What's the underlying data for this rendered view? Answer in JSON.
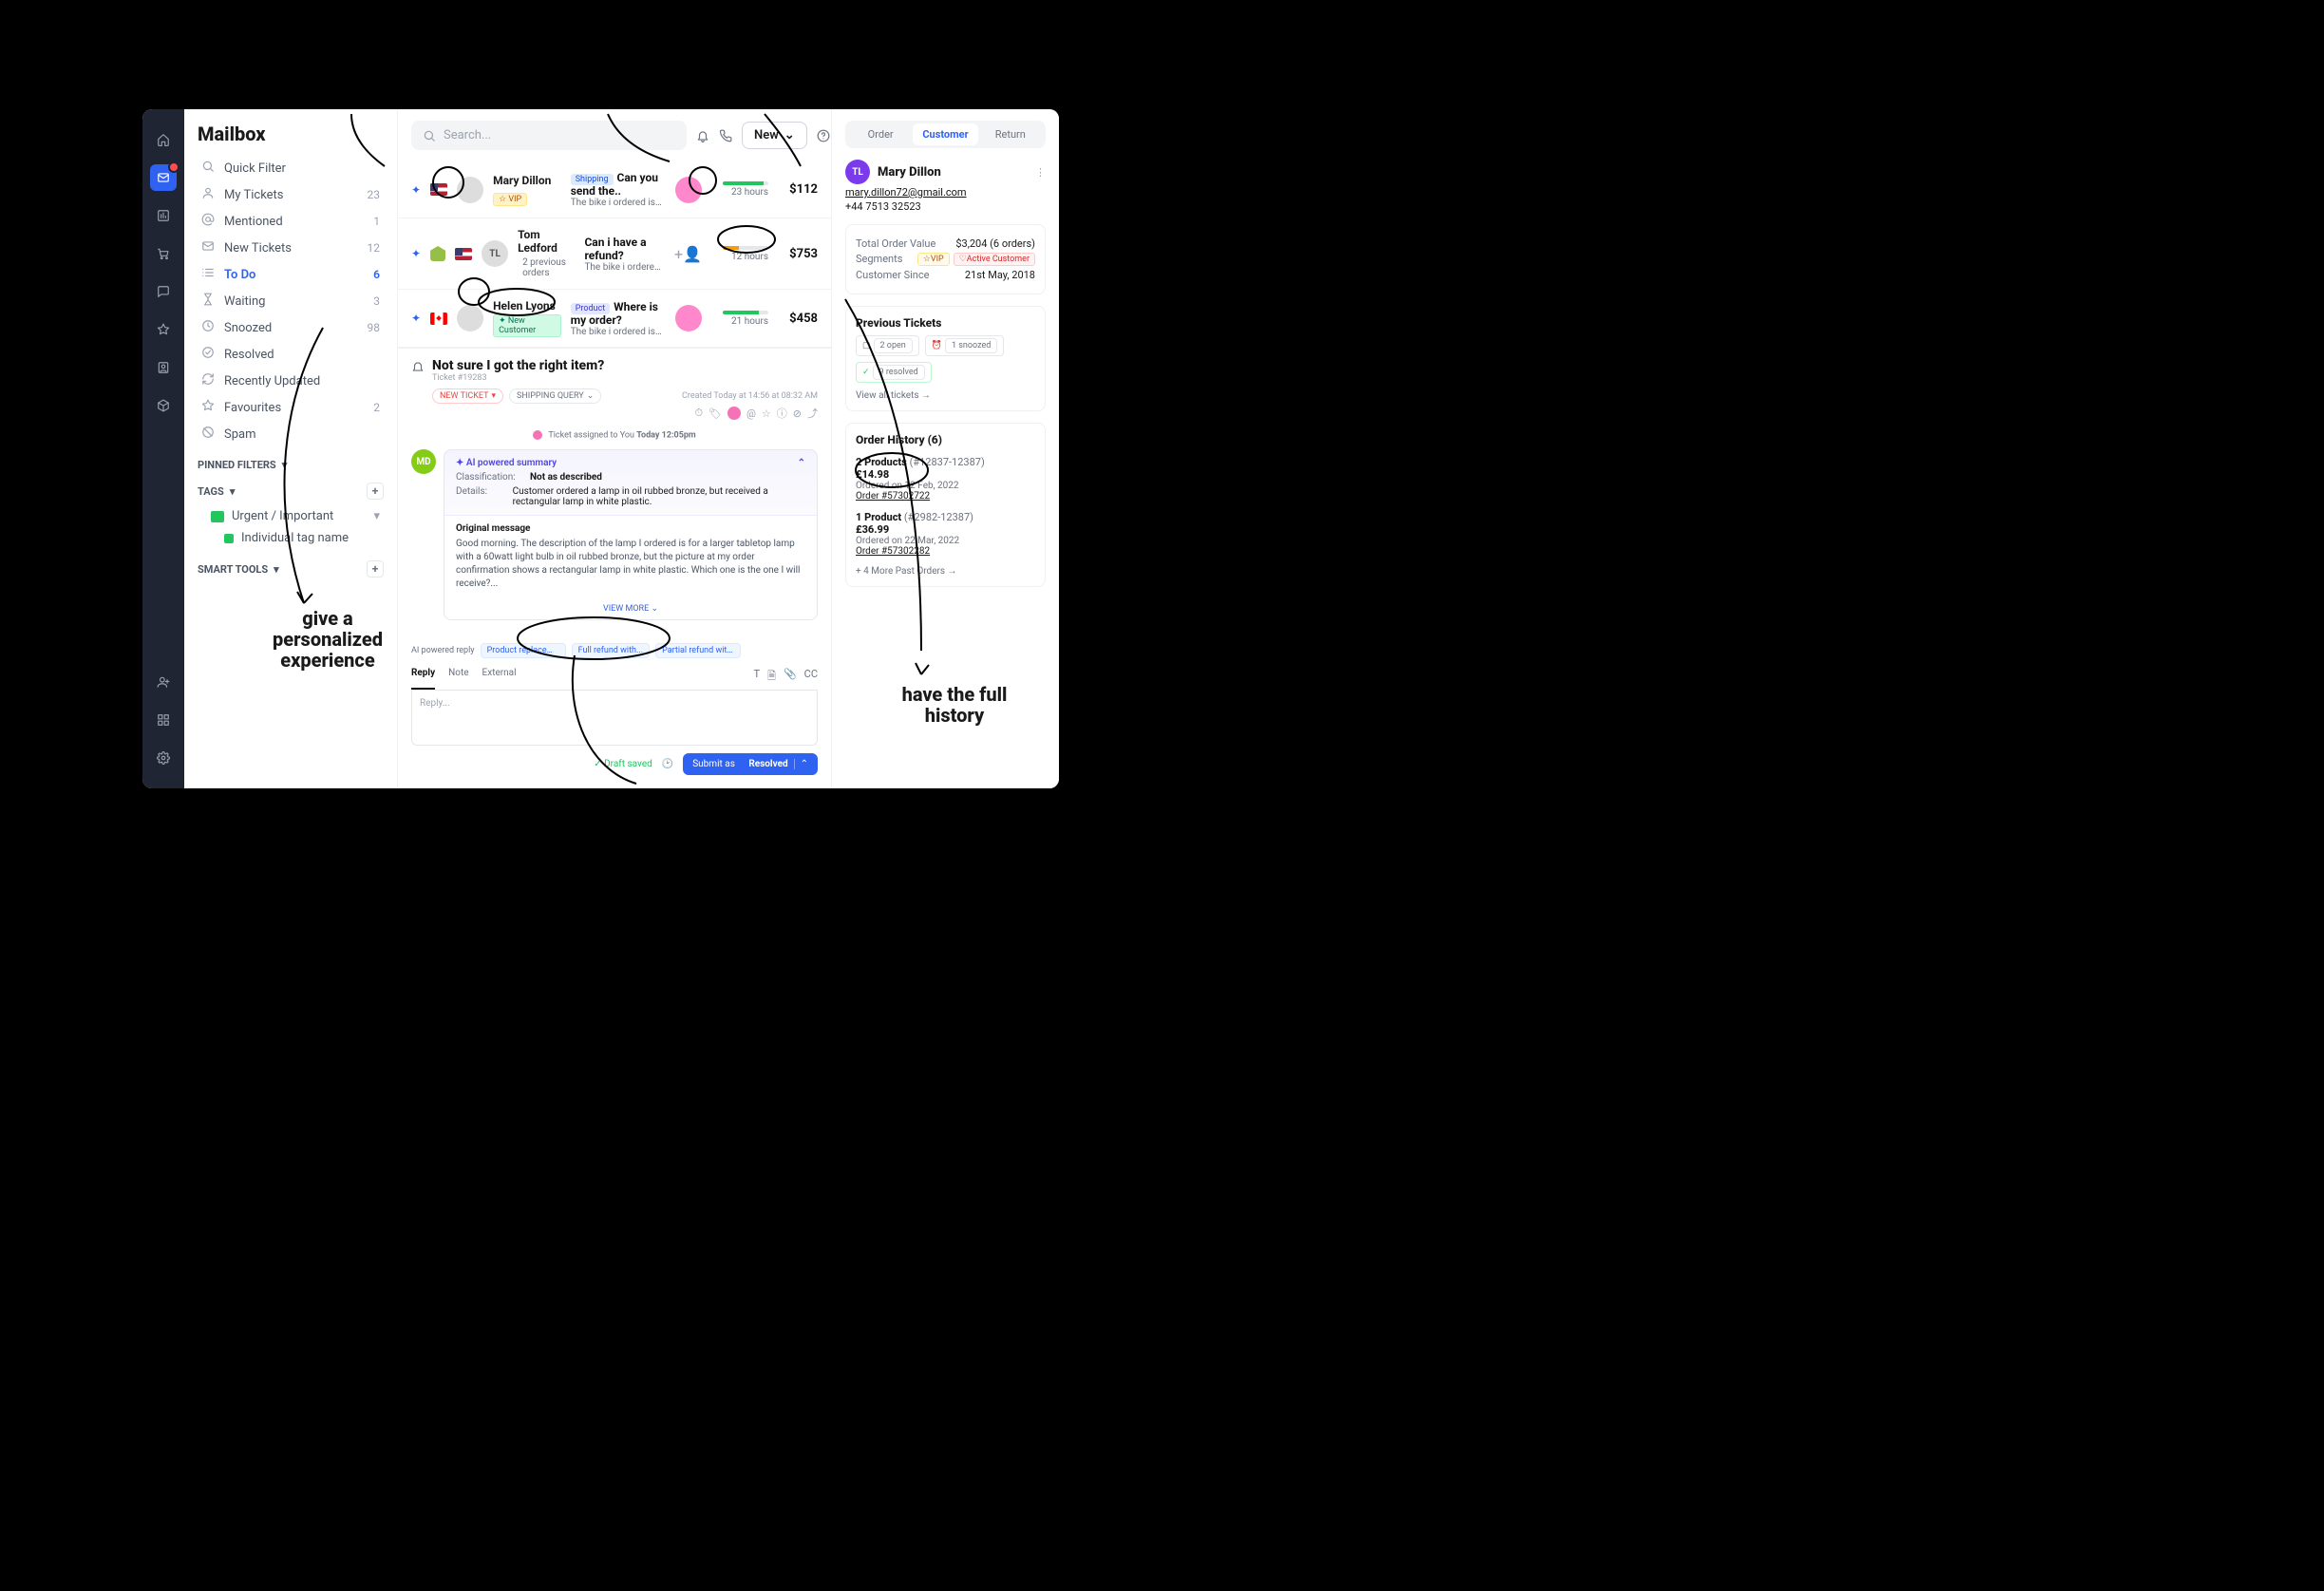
{
  "app": {
    "title": "Mailbox"
  },
  "topbar": {
    "search_placeholder": "Search...",
    "new_label": "New"
  },
  "sidebar": {
    "items": [
      {
        "icon": "search",
        "label": "Quick Filter",
        "count": ""
      },
      {
        "icon": "user",
        "label": "My Tickets",
        "count": "23"
      },
      {
        "icon": "at",
        "label": "Mentioned",
        "count": "1"
      },
      {
        "icon": "inbox",
        "label": "New Tickets",
        "count": "12"
      },
      {
        "icon": "list",
        "label": "To Do",
        "count": "6",
        "active": true
      },
      {
        "icon": "hourglass",
        "label": "Waiting",
        "count": "3"
      },
      {
        "icon": "clock",
        "label": "Snoozed",
        "count": "98"
      },
      {
        "icon": "check",
        "label": "Resolved",
        "count": ""
      },
      {
        "icon": "refresh",
        "label": "Recently Updated",
        "count": ""
      },
      {
        "icon": "star",
        "label": "Favourites",
        "count": "2"
      },
      {
        "icon": "ban",
        "label": "Spam",
        "count": ""
      }
    ],
    "pinned_label": "PINNED FILTERS",
    "tags_label": "TAGS",
    "tag_folder": "Urgent / Important",
    "tag_item": "Individual tag name",
    "smart_label": "SMART TOOLS"
  },
  "tickets": [
    {
      "flag": "us",
      "avatar": "",
      "name": "Mary Dillon",
      "badge_type": "vip",
      "badge": "☆ VIP",
      "cat_type": "ship",
      "cat": "Shipping",
      "subject": "Can you send the..",
      "preview": "The bike i ordered isn't the right...",
      "bar": 90,
      "bar_class": "",
      "time": "23 hours",
      "amount": "$112"
    },
    {
      "flag": "us",
      "shopify": true,
      "avatar": "TL",
      "name": "Tom Ledford",
      "badge_type": "prev",
      "badge": "2 previous orders",
      "cat_type": "",
      "cat": "",
      "subject": "Can i have a refund?",
      "preview": "The bike i ordered isn't the rig...",
      "bar": 35,
      "bar_class": "warn",
      "time": "12 hours",
      "amount": "$753"
    },
    {
      "flag": "ca",
      "avatar": "",
      "name": "Helen Lyons",
      "badge_type": "new",
      "badge": "✦ New Customer",
      "cat_type": "prod",
      "cat": "Product",
      "subject": "Where is my order?",
      "preview": "The bike i ordered isn't the right s...",
      "bar": 80,
      "bar_class": "",
      "time": "21 hours",
      "amount": "$458"
    }
  ],
  "ticket": {
    "title": "Not sure I got the right item?",
    "ref": "Ticket #19283",
    "pill_new": "NEW TICKET",
    "pill_query": "SHIPPING QUERY",
    "created": "Created Today at 14:56 at 08:32 AM",
    "assigned_prefix": "Ticket assigned to You",
    "assigned_time": "Today 12:05pm",
    "avatar": "MD",
    "ai_header": "AI powered summary",
    "classification_k": "Classification:",
    "classification_v": "Not as described",
    "details_k": "Details:",
    "details_v": "Customer ordered a lamp in oil rubbed bronze, but received a rectangular lamp in white plastic.",
    "original_h": "Original message",
    "original_b": "Good morning. The description of the lamp I ordered is for a larger tabletop lamp with a 60watt light bulb in oil rubbed bronze, but the picture at my order confirmation shows a rectangular lamp in white plastic. Which one is the one I will receive?...",
    "view_more": "VIEW MORE"
  },
  "reply": {
    "ai_label": "AI powered reply",
    "chips": [
      "Product replacement",
      "Full refund with...",
      "Partial refund with..."
    ],
    "tabs": [
      "Reply",
      "Note",
      "External"
    ],
    "tools_cc": "CC",
    "placeholder": "Reply...",
    "draft": "Draft saved",
    "submit_prefix": "Submit as",
    "submit_status": "Resolved"
  },
  "right": {
    "tabs": [
      "Order",
      "Customer",
      "Return"
    ],
    "customer": {
      "initials": "TL",
      "name": "Mary Dillon",
      "email": "mary.dillon72@gmail.com",
      "phone": "+44 7513 32523"
    },
    "stats": {
      "tov_k": "Total Order Value",
      "tov_v": "$3,204 (6 orders)",
      "seg_k": "Segments",
      "seg_vip": "☆VIP",
      "seg_active": "♡Active Customer",
      "since_k": "Customer Since",
      "since_v": "21st May, 2018"
    },
    "pt": {
      "title": "Previous Tickets",
      "open": "2 open",
      "snoozed": "1 snoozed",
      "resolved": "9 resolved",
      "view_all": "View all tickets →"
    },
    "orders": {
      "title": "Order History (6)",
      "items": [
        {
          "title": "2 Products",
          "range": "(#12837-12387)",
          "price": "£14.98",
          "date": "Ordered on 12 Feb, 2022",
          "link": "Order #57302722"
        },
        {
          "title": "1 Product",
          "range": "(#2982-12387)",
          "price": "£36.99",
          "date": "Ordered on 22 Mar, 2022",
          "link": "Order #57302282"
        }
      ],
      "more": "+ 4 More Past Orders →"
    }
  },
  "annotations": {
    "personalized": "give a\npersonalized\nexperience",
    "history": "have the full\nhistory"
  }
}
